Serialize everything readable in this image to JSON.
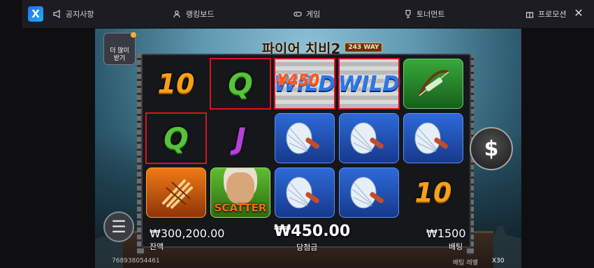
{
  "nav": {
    "logo": "X",
    "items": [
      {
        "label": "공지사항",
        "icon": "megaphone-icon"
      },
      {
        "label": "랭킹보드",
        "icon": "users-icon"
      },
      {
        "label": "게임",
        "icon": "gamepad-icon"
      },
      {
        "label": "토너먼트",
        "icon": "trophy-icon"
      },
      {
        "label": "프로모션",
        "icon": "gift-icon"
      }
    ],
    "close": "✕"
  },
  "game": {
    "title": "파이어 치비2",
    "title_badge": "243 WAY",
    "promo": {
      "line1": "더 많이",
      "line2": "받기"
    },
    "win_overlay": "¥450",
    "reels": [
      [
        "10",
        "Q",
        "orange-bamboo-tile"
      ],
      [
        "Q",
        "J",
        "scatter"
      ],
      [
        "WILD",
        "blue-fan-tile",
        "blue-fan-tile"
      ],
      [
        "WILD",
        "blue-fan-tile",
        "blue-fan-tile"
      ],
      [
        "green-bow-tile",
        "blue-fan-tile",
        "10"
      ]
    ],
    "scatter_label": "SCATTER",
    "spin_symbol": "$",
    "menu_symbol": "☰",
    "balance": {
      "value": "₩300,200.00",
      "label": "잔액"
    },
    "win": {
      "value": "₩450.00",
      "label": "당첨금"
    },
    "bet": {
      "value": "₩1500",
      "label": "배팅"
    },
    "round_id": "768938054461",
    "bet_level_label": "배팅 레벨",
    "bet_level_value": "X30"
  }
}
